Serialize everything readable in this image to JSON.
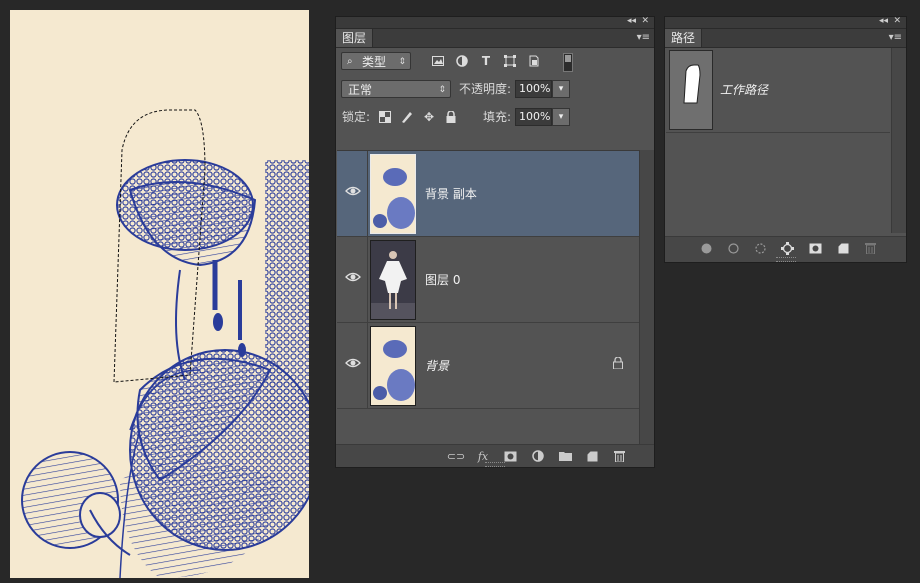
{
  "layers_panel": {
    "tab": "图层",
    "filter_label": "类型",
    "blend_mode": "正常",
    "opacity_label": "不透明度:",
    "opacity_value": "100%",
    "lock_label": "锁定:",
    "fill_label": "填充:",
    "fill_value": "100%",
    "layers": [
      {
        "name": "背景 副本",
        "selected": true,
        "italic": false
      },
      {
        "name": "图层 0",
        "selected": false,
        "italic": false
      },
      {
        "name": "背景",
        "selected": false,
        "italic": true,
        "locked": true
      }
    ]
  },
  "paths_panel": {
    "tab": "路径",
    "paths": [
      {
        "name": "工作路径"
      }
    ]
  },
  "icons": {
    "collapse": "double-chevron-icon",
    "close": "close-icon",
    "menu": "panel-menu-icon",
    "visibility": "eye-icon",
    "lock": "lock-icon"
  },
  "colors": {
    "selected_row": "#56667b",
    "panel_bg": "#535353",
    "workspace_bg": "#282828",
    "ink_blue": "#2a3c9a",
    "paper": "#f5e9d0"
  }
}
